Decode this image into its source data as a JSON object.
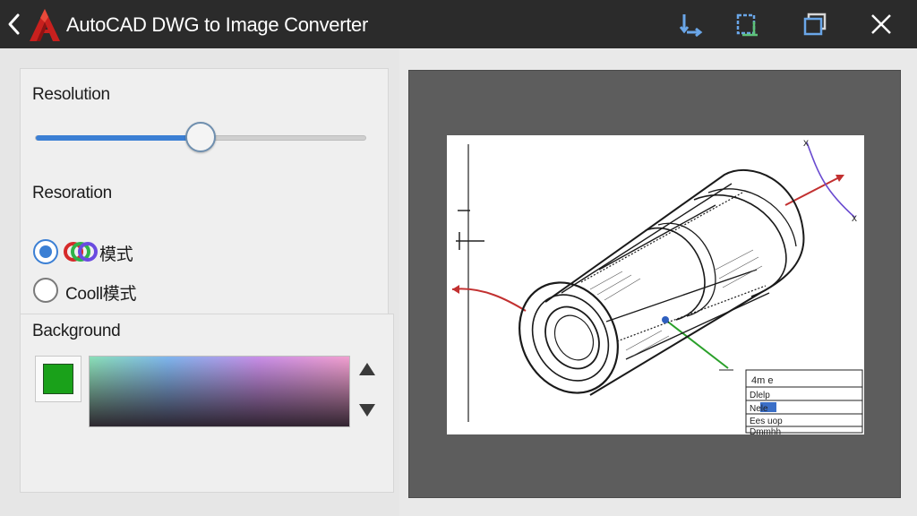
{
  "titlebar": {
    "title": "AutoCAD DWG to Image Converter",
    "icons": {
      "back": "chevron-left-icon",
      "logo": "autocad-logo",
      "action1": "convert-arrows-icon",
      "action2": "crop-selection-icon",
      "action3": "window-restore-icon",
      "close": "close-icon"
    }
  },
  "settings": {
    "resolution": {
      "label": "Resolution",
      "slider_value_fraction": 0.5
    },
    "resoration": {
      "label": "Resoration",
      "options": [
        {
          "label": "模式",
          "icon": "rgb-circles-icon",
          "selected": true
        },
        {
          "label": "Cooll模式",
          "selected": false
        }
      ]
    },
    "background": {
      "label": "Background",
      "selected_color": "#1aa11a",
      "up_icon": "triangle-up-icon",
      "down_icon": "triangle-down-icon"
    }
  },
  "preview": {
    "title_block": {
      "header": "4m e",
      "rows": [
        "Dlelp",
        "Nele",
        "Ees uop",
        "Dmmhh"
      ]
    }
  },
  "colors": {
    "titlebar": "#2b2b2b",
    "accent": "#3b7fd4",
    "logo": "#c8201e",
    "preview_bg": "#5d5d5d"
  }
}
